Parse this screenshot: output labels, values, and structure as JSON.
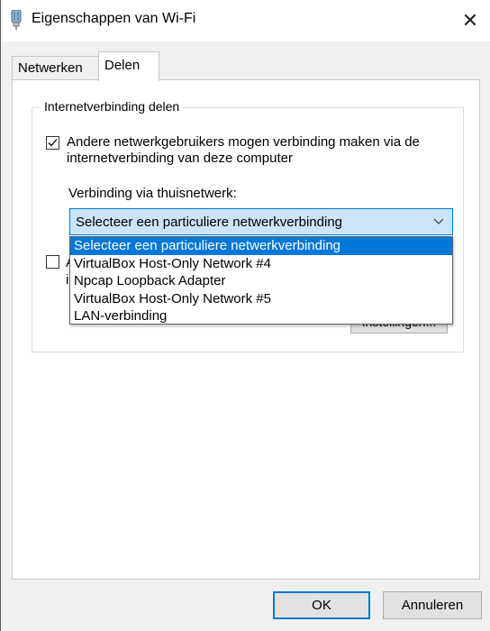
{
  "window": {
    "title": "Eigenschappen van Wi-Fi",
    "close_symbol": "✕"
  },
  "tabs": [
    {
      "label": "Netwerken",
      "active": false
    },
    {
      "label": "Delen",
      "active": true
    }
  ],
  "sharing": {
    "group_title": "Internetverbinding delen",
    "allow_checkbox": {
      "checked": true,
      "label": "Andere netwerkgebruikers mogen verbinding maken via de internetverbinding van deze computer"
    },
    "home_network_label": "Verbinding via thuisnetwerk:",
    "select": {
      "value": "Selecteer een particuliere netwerkverbinding",
      "options": [
        "Selecteer een particuliere netwerkverbinding",
        "VirtualBox Host-Only Network #4",
        "Npcap Loopback Adapter",
        "VirtualBox Host-Only Network #5",
        "LAN-verbinding"
      ],
      "selected_index": 0
    },
    "second_checkbox": {
      "checked": false,
      "label_start_1": "A",
      "label_start_2": "i"
    },
    "settings_button_partial": "Instellingen..."
  },
  "buttons": {
    "ok": "OK",
    "cancel": "Annuleren"
  },
  "colors": {
    "accent": "#0078d7",
    "select_bg": "#cce4f7"
  }
}
